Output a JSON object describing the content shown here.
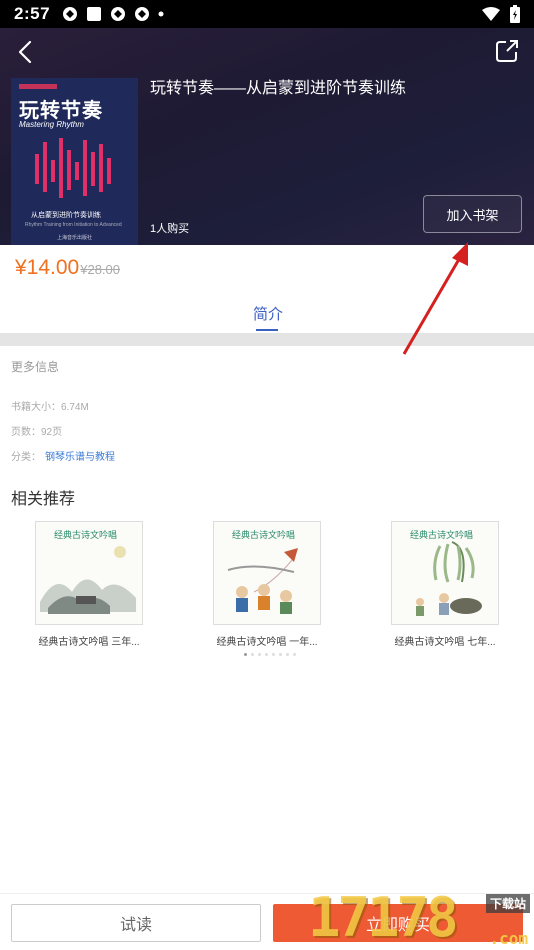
{
  "status_bar": {
    "time": "2:57"
  },
  "book": {
    "title": "玩转节奏——从启蒙到进阶节奏训练",
    "buyers": "1人购买",
    "add_to_shelf": "加入书架",
    "cover": {
      "title": "玩转节奏",
      "subtitle": "Mastering Rhythm",
      "line": "从启蒙到进阶节奏训练",
      "line2": "Rhythm Training from Initiation to Advanced",
      "publisher": "上海音乐出版社"
    }
  },
  "price": {
    "current": "¥14.00",
    "original": "¥28.00"
  },
  "tabs": [
    {
      "label": "简介"
    }
  ],
  "info": {
    "heading": "更多信息",
    "size": "书籍大小：6.74M",
    "pages": "页数：92页",
    "category_label": "分类：",
    "category_value": "钢琴乐谱与教程"
  },
  "recommend": {
    "heading": "相关推荐",
    "items": [
      {
        "label": "经典古诗文吟唱 三年...",
        "badge": "经典古诗文吟唱"
      },
      {
        "label": "经典古诗文吟唱 一年...",
        "badge": "经典古诗文吟唱"
      },
      {
        "label": "经典古诗文吟唱 七年...",
        "badge": "经典古诗文吟唱"
      }
    ]
  },
  "bottom": {
    "try_read": "试读",
    "buy_now": "立即购买"
  },
  "watermark": {
    "text": "17178",
    "download": "下载站",
    "domain": ".com"
  },
  "colors": {
    "accent": "#3a60c0",
    "price": "#f07020",
    "buy": "#ee5a34"
  }
}
